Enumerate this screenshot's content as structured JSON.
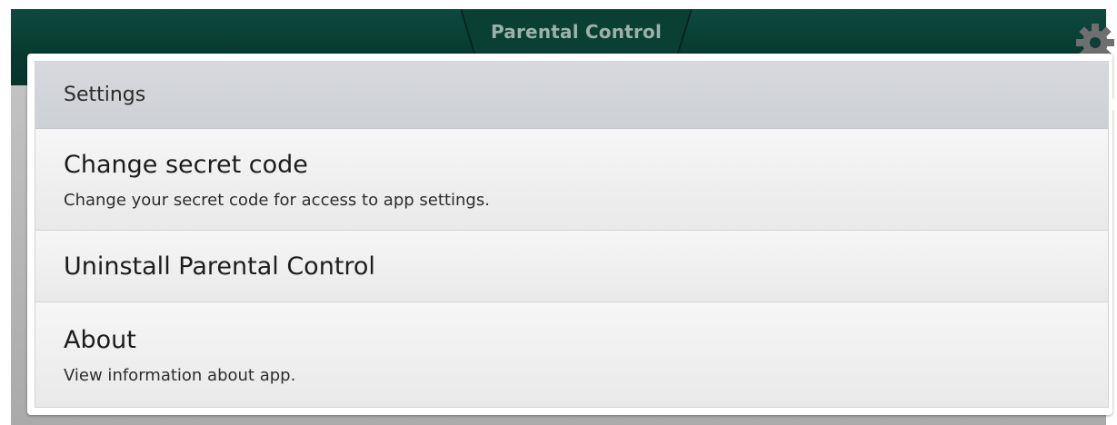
{
  "action_bar": {
    "title": "Parental Control",
    "settings_icon": "gear-icon"
  },
  "popup_menu": {
    "header": "Settings",
    "items": [
      {
        "title": "Change secret code",
        "subtitle": "Change your secret code for access to app settings."
      },
      {
        "title": "Uninstall Parental Control",
        "subtitle": ""
      },
      {
        "title": "About",
        "subtitle": "View information about app."
      }
    ]
  },
  "colors": {
    "action_bar": "#0b4338",
    "menu_header": "#d3d6db",
    "menu_item": "#efefef"
  }
}
